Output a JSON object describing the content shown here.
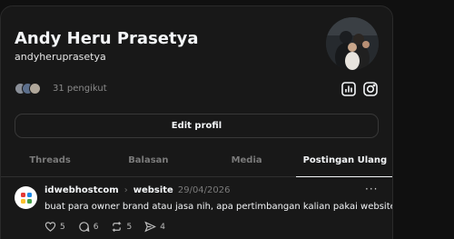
{
  "profile": {
    "name": "Andy Heru Prasetya",
    "handle": "andyheruprasetya",
    "followers_text": "31 pengikut",
    "follower_avatar_colors": [
      "#8a8f98",
      "#5c6f8c",
      "#b0a79a"
    ]
  },
  "actions": {
    "edit_profile_label": "Edit profil",
    "insights_icon": "bar-chart-icon",
    "instagram_icon": "instagram-icon"
  },
  "tabs": [
    {
      "label": "Threads"
    },
    {
      "label": "Balasan"
    },
    {
      "label": "Media"
    },
    {
      "label": "Postingan Ulang"
    }
  ],
  "post": {
    "username": "idwebhostcom",
    "topic": "website",
    "date": "29/04/2026",
    "text": "buat para owner brand atau jasa nih, apa pertimbangan kalian pakai website?",
    "likes": "5",
    "comments": "6",
    "reposts": "5",
    "shares": "4"
  },
  "colors": {
    "background": "#101010",
    "panel": "#181818",
    "text_primary": "#f3f5f7",
    "text_secondary": "#7a7a7a"
  }
}
